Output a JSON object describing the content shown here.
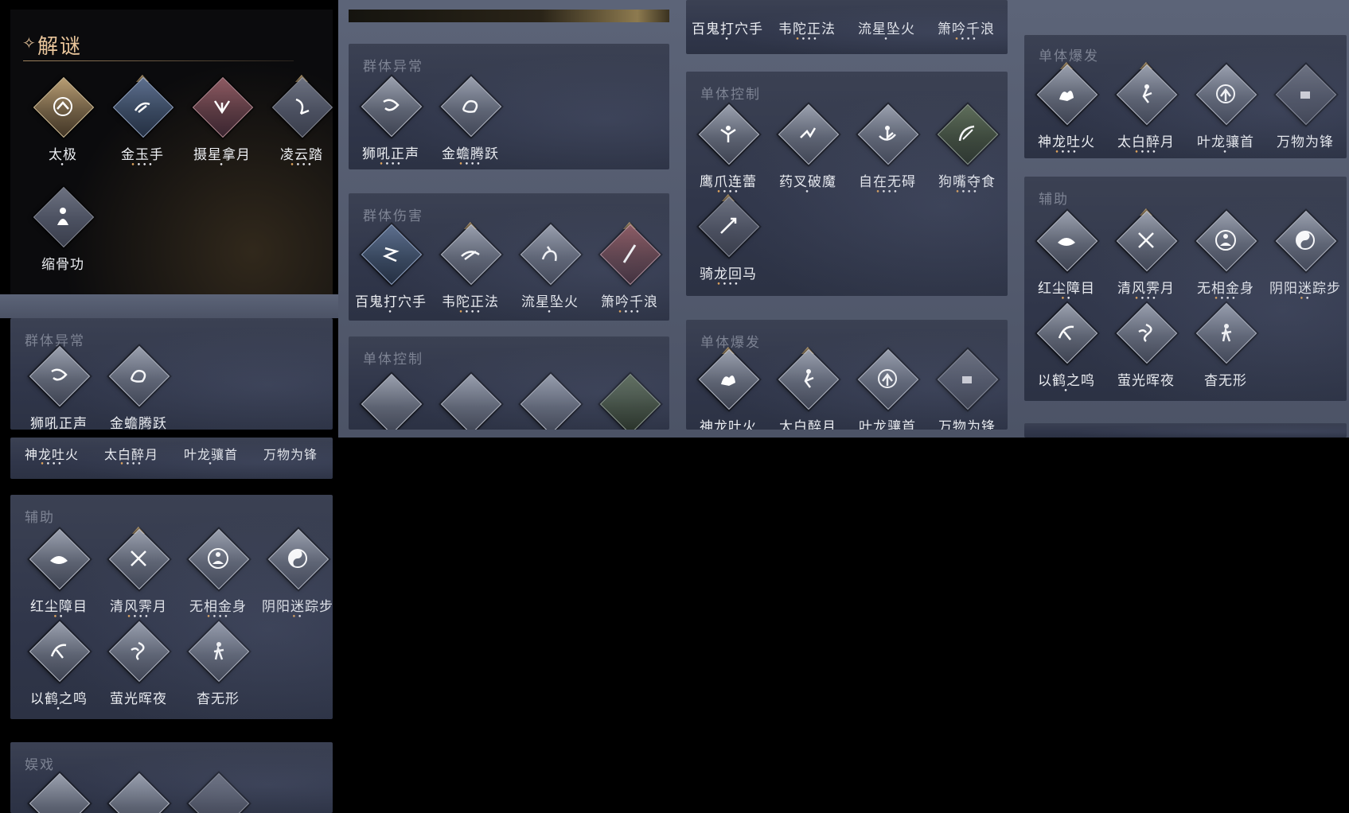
{
  "puzzle": {
    "title": "解谜",
    "star": "✧"
  },
  "sections": {
    "qunti_yichang": "群体异常",
    "qunti_shanghai": "群体伤害",
    "danti_kongzhi": "单体控制",
    "danti_baofa": "单体爆发",
    "fuzhu": "辅助",
    "yuxi": "娱戏"
  },
  "skills": {
    "taiji": {
      "name": "太极",
      "dots": "•"
    },
    "jinyushou": {
      "name": "金玉手",
      "dots": "••••"
    },
    "shexingnayue": {
      "name": "摄星拿月",
      "dots": "•"
    },
    "lingyunta": {
      "name": "凌云踏",
      "dots": "••••"
    },
    "suogugong": {
      "name": "缩骨功",
      "dots": ""
    },
    "shihouzhengsheng": {
      "name": "狮吼正声",
      "dots": "••••"
    },
    "jinchantengyue": {
      "name": "金蟾腾跃",
      "dots": "••••"
    },
    "baiguidaxueshou": {
      "name": "百鬼打穴手",
      "dots": "•"
    },
    "weituozhengfa": {
      "name": "韦陀正法",
      "dots": "••••"
    },
    "liuxingzhuihuo": {
      "name": "流星坠火",
      "dots": "•"
    },
    "xiaoyinqianlang": {
      "name": "箫吟千浪",
      "dots": "••••"
    },
    "yingzhaolianlei": {
      "name": "鹰爪连蕾",
      "dots": "••••"
    },
    "yaochapomo": {
      "name": "药叉破魔",
      "dots": "•"
    },
    "zizaiwuai": {
      "name": "自在无碍",
      "dots": "••••"
    },
    "goujiaoduoshi": {
      "name": "狗嘴夺食",
      "dots": "••••"
    },
    "qilonghuima": {
      "name": "骑龙回马",
      "dots": "••••"
    },
    "shenlongtuhuo": {
      "name": "神龙吐火",
      "dots": "••••"
    },
    "taibaizuiyue": {
      "name": "太白醉月",
      "dots": "••••"
    },
    "yelongxiangshou": {
      "name": "叶龙骧首",
      "dots": "•"
    },
    "wanwuweifeng": {
      "name": "万物为锋",
      "dots": ""
    },
    "hongchenzhangmu": {
      "name": "红尘障目",
      "dots": "••"
    },
    "qingfengjiyue": {
      "name": "清风霁月",
      "dots": "••••"
    },
    "wuxiangjinshen": {
      "name": "无相金身",
      "dots": "••••"
    },
    "yinyangmizongbu": {
      "name": "阴阳迷踪步",
      "dots": "••"
    },
    "yihezhiming": {
      "name": "以鹤之鸣",
      "dots": "•"
    },
    "yingguanghuiye": {
      "name": "萤光晖夜",
      "dots": ""
    },
    "yaowuxing": {
      "name": "杳无形",
      "dots": ""
    }
  },
  "bottom_strip": {
    "a": "神龙吐火",
    "b": "太白醉月",
    "c": "叶龙骧首",
    "d": "万物为锋",
    "a_dots": "••••",
    "b_dots": "••••",
    "c_dots": "•",
    "d_dots": ""
  },
  "colors": {
    "accent_gold": "#e9c59b",
    "dot_orange": "#e0a45c",
    "panel": "#363c4f"
  }
}
